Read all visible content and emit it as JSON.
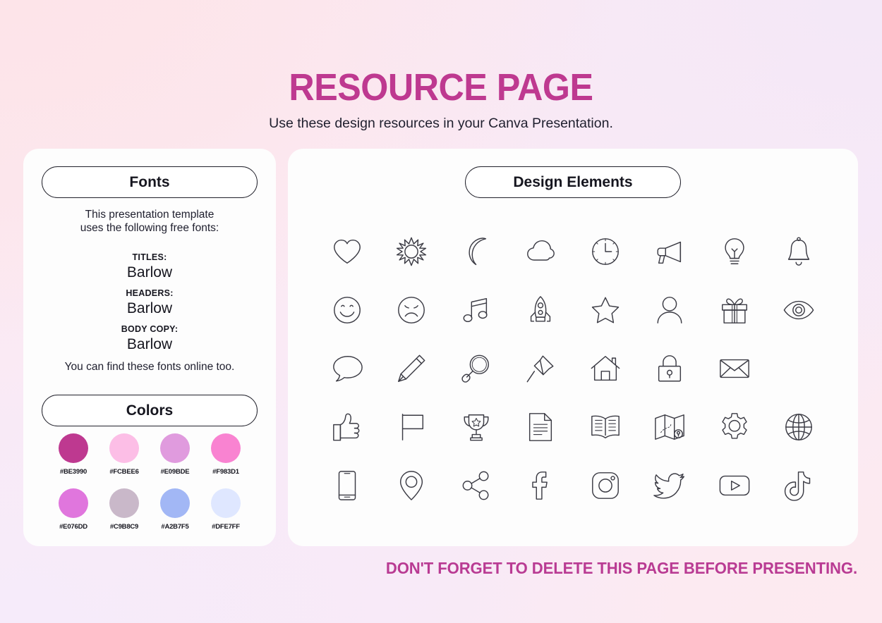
{
  "header": {
    "title": "RESOURCE PAGE",
    "subtitle": "Use these design resources in your Canva Presentation."
  },
  "fonts_panel": {
    "pill_label": "Fonts",
    "intro_line1": "This presentation template",
    "intro_line2": "uses the following free fonts:",
    "entries": [
      {
        "label": "TITLES:",
        "value": "Barlow"
      },
      {
        "label": "HEADERS:",
        "value": "Barlow"
      },
      {
        "label": "BODY COPY:",
        "value": "Barlow"
      }
    ],
    "outro": "You can find these fonts online too."
  },
  "colors_panel": {
    "pill_label": "Colors",
    "rows": [
      [
        {
          "hex": "#BE3990",
          "label": "#BE3990"
        },
        {
          "hex": "#FCBEE6",
          "label": "#FCBEE6"
        },
        {
          "hex": "#E09BDE",
          "label": "#E09BDE"
        },
        {
          "hex": "#F983D1",
          "label": "#F983D1"
        }
      ],
      [
        {
          "hex": "#E076DD",
          "label": "#E076DD"
        },
        {
          "hex": "#C9B8C9",
          "label": "#C9B8C9"
        },
        {
          "hex": "#A2B7F5",
          "label": "#A2B7F5"
        },
        {
          "hex": "#DFE7FF",
          "label": "#DFE7FF"
        }
      ]
    ]
  },
  "elements_panel": {
    "pill_label": "Design Elements",
    "icon_rows": [
      [
        "heart-icon",
        "sun-icon",
        "moon-icon",
        "cloud-icon",
        "clock-icon",
        "megaphone-icon",
        "lightbulb-icon",
        "bell-icon"
      ],
      [
        "smiley-face-icon",
        "sad-face-icon",
        "music-note-icon",
        "rocket-icon",
        "star-icon",
        "person-icon",
        "gift-icon",
        "eye-icon"
      ],
      [
        "speech-bubble-icon",
        "pencil-icon",
        "magnifier-icon",
        "pushpin-icon",
        "house-icon",
        "lock-icon",
        "envelope-icon"
      ],
      [
        "thumbs-up-icon",
        "flag-icon",
        "trophy-icon",
        "document-icon",
        "book-icon",
        "map-icon",
        "gear-icon",
        "globe-icon"
      ],
      [
        "phone-icon",
        "location-pin-icon",
        "share-icon",
        "facebook-icon",
        "instagram-icon",
        "twitter-icon",
        "youtube-icon",
        "tiktok-icon"
      ]
    ]
  },
  "footer": {
    "note": "DON'T FORGET TO DELETE THIS PAGE BEFORE PRESENTING.",
    "accent_color": "#B93B93"
  }
}
